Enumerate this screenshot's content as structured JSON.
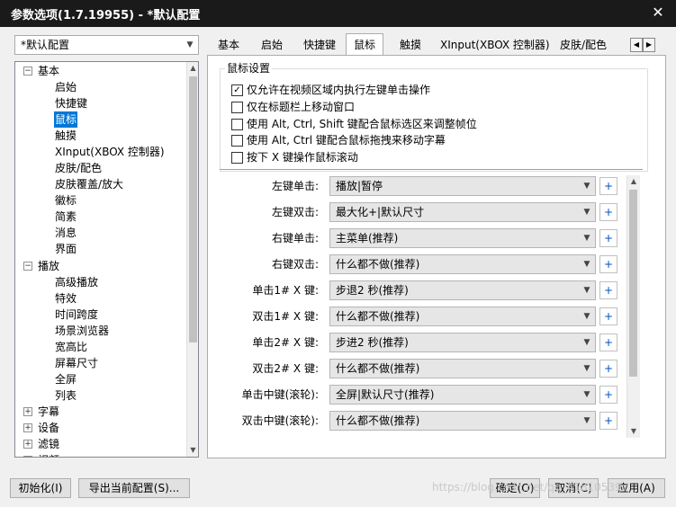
{
  "window": {
    "title": "参数选项(1.7.19955) - *默认配置",
    "close_glyph": "✕"
  },
  "profile": {
    "selected": "*默认配置"
  },
  "tabs": [
    "基本",
    "启始",
    "快捷键",
    "鼠标",
    "触摸",
    "XInput(XBOX 控制器)",
    "皮肤/配色"
  ],
  "active_tab": "鼠标",
  "tree": {
    "basic": "基本",
    "basic_children": [
      "启始",
      "快捷键",
      "鼠标",
      "触摸",
      "XInput(XBOX 控制器)",
      "皮肤/配色",
      "皮肤覆盖/放大",
      "徽标",
      "简素",
      "消息",
      "界面"
    ],
    "play": "播放",
    "play_children": [
      "高级播放",
      "特效",
      "时间跨度",
      "场景浏览器",
      "宽高比",
      "屏幕尺寸",
      "全屏",
      "列表"
    ],
    "collapsed": [
      "字幕",
      "设备",
      "滤镜",
      "视频"
    ]
  },
  "group": {
    "title": "鼠标设置",
    "checkboxes": [
      {
        "label": "仅允许在视频区域内执行左键单击操作",
        "checked": true
      },
      {
        "label": "仅在标题栏上移动窗口",
        "checked": false
      },
      {
        "label": "使用 Alt, Ctrl, Shift 键配合鼠标选区来调整帧位",
        "checked": false
      },
      {
        "label": "使用 Alt, Ctrl 键配合鼠标拖拽来移动字幕",
        "checked": false
      },
      {
        "label": "按下 X 键操作鼠标滚动",
        "checked": false
      }
    ]
  },
  "mouse_actions": [
    {
      "label": "左键单击:",
      "value": "播放|暂停"
    },
    {
      "label": "左键双击:",
      "value": "最大化+|默认尺寸"
    },
    {
      "label": "右键单击:",
      "value": "主菜单(推荐)"
    },
    {
      "label": "右键双击:",
      "value": "什么都不做(推荐)"
    },
    {
      "label": "单击1# X 键:",
      "value": "步退2 秒(推荐)"
    },
    {
      "label": "双击1# X 键:",
      "value": "什么都不做(推荐)"
    },
    {
      "label": "单击2# X 键:",
      "value": "步进2 秒(推荐)"
    },
    {
      "label": "双击2# X 键:",
      "value": "什么都不做(推荐)"
    },
    {
      "label": "单击中键(滚轮):",
      "value": "全屏|默认尺寸(推荐)"
    },
    {
      "label": "双击中键(滚轮):",
      "value": "什么都不做(推荐)"
    }
  ],
  "plus_glyph": "+",
  "buttons": {
    "init": "初始化(I)",
    "export": "导出当前配置(S)...",
    "ok": "确定(O)",
    "cancel": "取消(C)",
    "apply": "应用(A)"
  },
  "watermark": "https://blog.csdn.net/qq_41810539",
  "colors": {
    "titlebar": "#1a1a1a",
    "selection": "#0078d7"
  }
}
